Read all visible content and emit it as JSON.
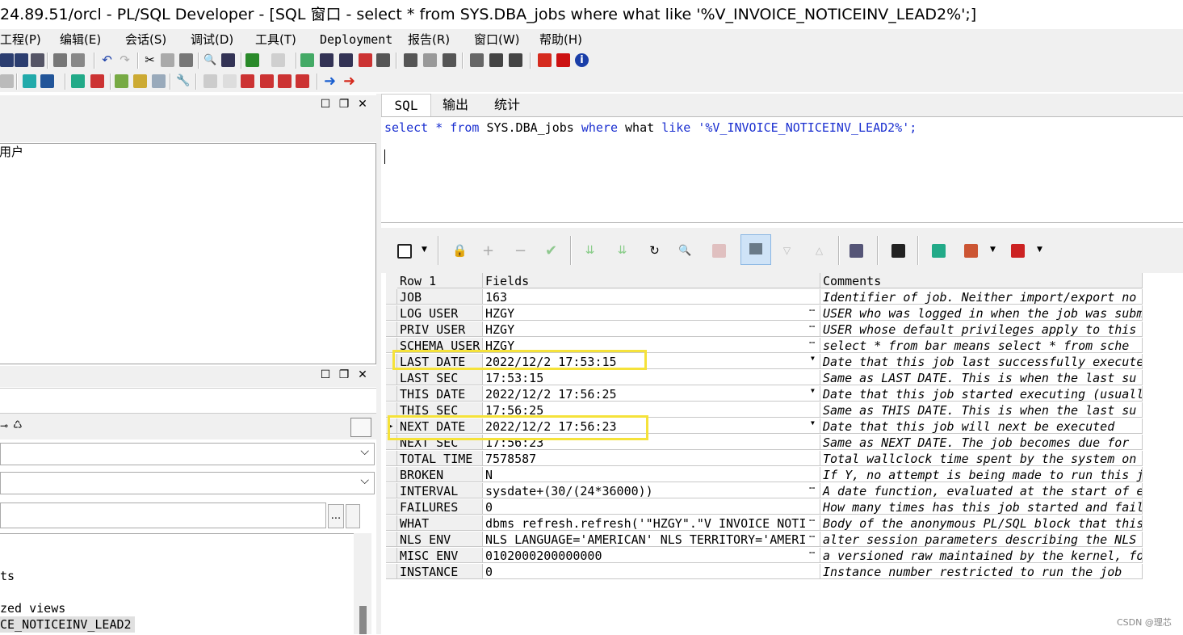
{
  "window": {
    "title": "24.89.51/orcl - PL/SQL Developer - [SQL 窗口 - select * from SYS.DBA_jobs where what like '%V_INVOICE_NOTICEINV_LEAD2%';]"
  },
  "menu": [
    "工程(P)",
    "编辑(E)",
    "会话(S)",
    "调试(D)",
    "工具(T)",
    "Deployment",
    "报告(R)",
    "窗口(W)",
    "帮助(H)"
  ],
  "left": {
    "tree_item": "用户",
    "objects": [
      "ts",
      "",
      "zed views",
      "CE_NOTICEINV_LEAD2"
    ],
    "browse_button": "..."
  },
  "tabs": [
    "SQL",
    "输出",
    "统计"
  ],
  "editor": {
    "kw_select": "select",
    "star": "*",
    "kw_from": "from",
    "table": "SYS.DBA_jobs",
    "kw_where": "where",
    "col": "what",
    "kw_like": "like",
    "literal": "'%V_INVOICE_NOTICEINV_LEAD2%'",
    "semi": ";"
  },
  "grid": {
    "headers": [
      "Row 1",
      "Fields",
      "Comments"
    ],
    "rows": [
      {
        "name": "JOB",
        "value": "163",
        "comment": "Identifier of job.  Neither import/export no"
      },
      {
        "name": "LOG_USER",
        "value": "HZGY",
        "comment": "USER who was logged in when the job was subm"
      },
      {
        "name": "PRIV_USER",
        "value": "HZGY",
        "comment": "USER whose default privileges apply to this"
      },
      {
        "name": "SCHEMA_USER",
        "value": "HZGY",
        "comment": "select * from bar  means  select * from sche"
      },
      {
        "name": "LAST_DATE",
        "value": "2022/12/2 17:53:15",
        "comment": "Date that this job last successfully execute"
      },
      {
        "name": "LAST_SEC",
        "value": "17:53:15",
        "comment": "Same as LAST_DATE.  This is when the last su"
      },
      {
        "name": "THIS_DATE",
        "value": "2022/12/2 17:56:25",
        "comment": "Date that this job started executing (usuall"
      },
      {
        "name": "THIS_SEC",
        "value": "17:56:25",
        "comment": "Same as THIS_DATE.  This is when the last su"
      },
      {
        "name": "NEXT_DATE",
        "value": "2022/12/2 17:56:23",
        "comment": "Date that this job will next be executed"
      },
      {
        "name": "NEXT_SEC",
        "value": "17:56:23",
        "comment": "Same as NEXT_DATE.  The job becomes due for"
      },
      {
        "name": "TOTAL_TIME",
        "value": "7578587",
        "comment": "Total wallclock time spent by the system on"
      },
      {
        "name": "BROKEN",
        "value": "N",
        "comment": "If Y, no attempt is being made to run this j"
      },
      {
        "name": "INTERVAL",
        "value": "sysdate+(30/(24*36000))",
        "comment": "A date function, evaluated at the start of e"
      },
      {
        "name": "FAILURES",
        "value": "0",
        "comment": "How many times has this job started and fail"
      },
      {
        "name": "WHAT",
        "value": "dbms_refresh.refresh('\"HZGY\".\"V_INVOICE_NOTI",
        "comment": "Body of the anonymous PL/SQL block that this"
      },
      {
        "name": "NLS_ENV",
        "value": "NLS_LANGUAGE='AMERICAN' NLS_TERRITORY='AMERI",
        "comment": "alter session parameters describing the NLS"
      },
      {
        "name": "MISC_ENV",
        "value": "0102000200000000",
        "comment": "a versioned raw maintained by the kernel, fo"
      },
      {
        "name": "INSTANCE",
        "value": "0",
        "comment": "Instance number restricted to run the job"
      }
    ]
  },
  "watermark": "CSDN @理芯",
  "colors": {
    "keyword": "#1a2fd0",
    "literal": "#1a2fd0",
    "highlight": "#f5e23a",
    "toolbar_bg": "#f0f0f0"
  }
}
